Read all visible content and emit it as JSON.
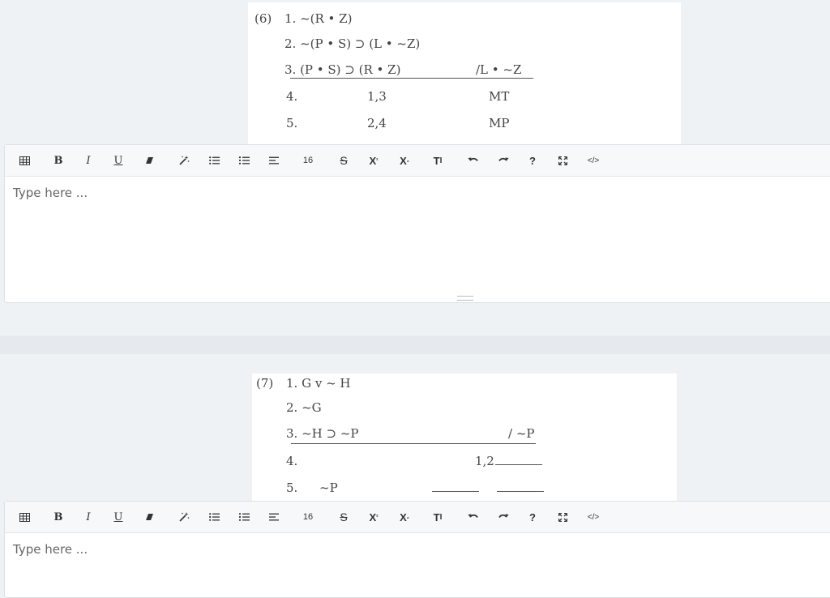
{
  "problem6": {
    "label": "(6)",
    "premises": [
      "1. ~(R • Z)",
      "2. ~(P • S) ⊃ (L • ~Z)",
      "3. (P • S) ⊃ (R • Z)"
    ],
    "conclusion": "/L • ~Z",
    "steps": [
      {
        "num": "4.",
        "just": "1,3",
        "rule": "MT"
      },
      {
        "num": "5.",
        "just": "2,4",
        "rule": "MP"
      }
    ]
  },
  "problem7": {
    "label": "(7)",
    "premises": [
      "1. G v ~ H",
      "2. ~G",
      "3. ~H ⊃ ~P"
    ],
    "conclusion": "/ ~P",
    "steps": [
      {
        "num": "4.",
        "just": "1,2",
        "formula": ""
      },
      {
        "num": "5.",
        "formula": "~P",
        "just": ""
      }
    ]
  },
  "toolbar": {
    "font_size": "16",
    "buttons": [
      "table-icon",
      "bold-icon",
      "italic-icon",
      "underline-icon",
      "eraser-icon",
      "magic-wand-icon",
      "bullet-list-icon",
      "numbered-list-icon",
      "align-icon",
      "font-size",
      "strikethrough-icon",
      "superscript-icon",
      "subscript-icon",
      "text-size-icon",
      "undo-icon",
      "redo-icon",
      "help-icon",
      "fullscreen-icon",
      "code-view-icon"
    ]
  },
  "editor6": {
    "placeholder": "Type here ..."
  },
  "editor7": {
    "placeholder": "Type here ..."
  }
}
